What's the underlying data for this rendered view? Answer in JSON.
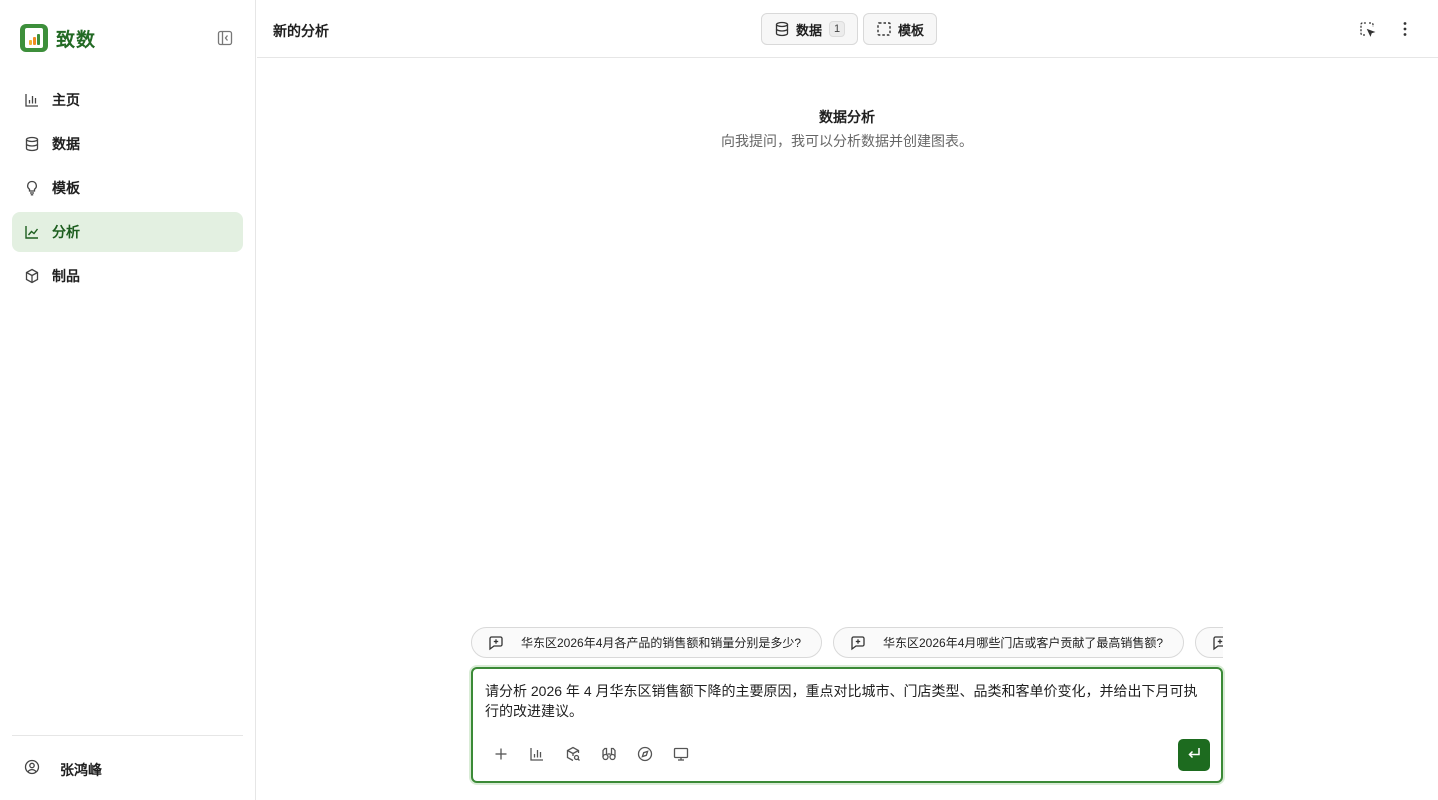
{
  "app": {
    "name": "致数"
  },
  "sidebar": {
    "items": [
      {
        "label": "主页",
        "icon": "bar-chart-icon",
        "active": false
      },
      {
        "label": "数据",
        "icon": "database-icon",
        "active": false
      },
      {
        "label": "模板",
        "icon": "lightbulb-icon",
        "active": false
      },
      {
        "label": "分析",
        "icon": "line-chart-icon",
        "active": true
      },
      {
        "label": "制品",
        "icon": "box-icon",
        "active": false
      }
    ],
    "user": {
      "name": "张鸿峰",
      "icon": "user-circle-icon"
    }
  },
  "header": {
    "title": "新的分析",
    "data_button": {
      "label": "数据",
      "count": "1",
      "icon": "database-icon"
    },
    "template_button": {
      "label": "模板",
      "icon": "dashed-square-icon"
    }
  },
  "main": {
    "title": "数据分析",
    "subtitle": "向我提问，我可以分析数据并创建图表。"
  },
  "suggestions": [
    {
      "label": "华东区2026年4月各产品的销售额和销量分别是多少?",
      "icon": "message-plus-icon"
    },
    {
      "label": "华东区2026年4月哪些门店或客户贡献了最高销售额?",
      "icon": "message-plus-icon"
    },
    {
      "label": "",
      "icon": "message-plus-icon"
    }
  ],
  "composer": {
    "text": "请分析 2026 年 4 月华东区销售额下降的主要原因，重点对比城市、门店类型、品类和客单价变化，并给出下月可执行的改进建议。",
    "tools": [
      "plus-icon",
      "bar-chart-icon",
      "package-search-icon",
      "binoculars-icon",
      "compass-icon",
      "monitor-icon"
    ],
    "send_icon": "enter-icon"
  },
  "colors": {
    "accent": "#3b8a37",
    "accent_dark": "#1d6b1f",
    "active_bg": "#e3f0e1",
    "brand_text": "#236a25"
  }
}
